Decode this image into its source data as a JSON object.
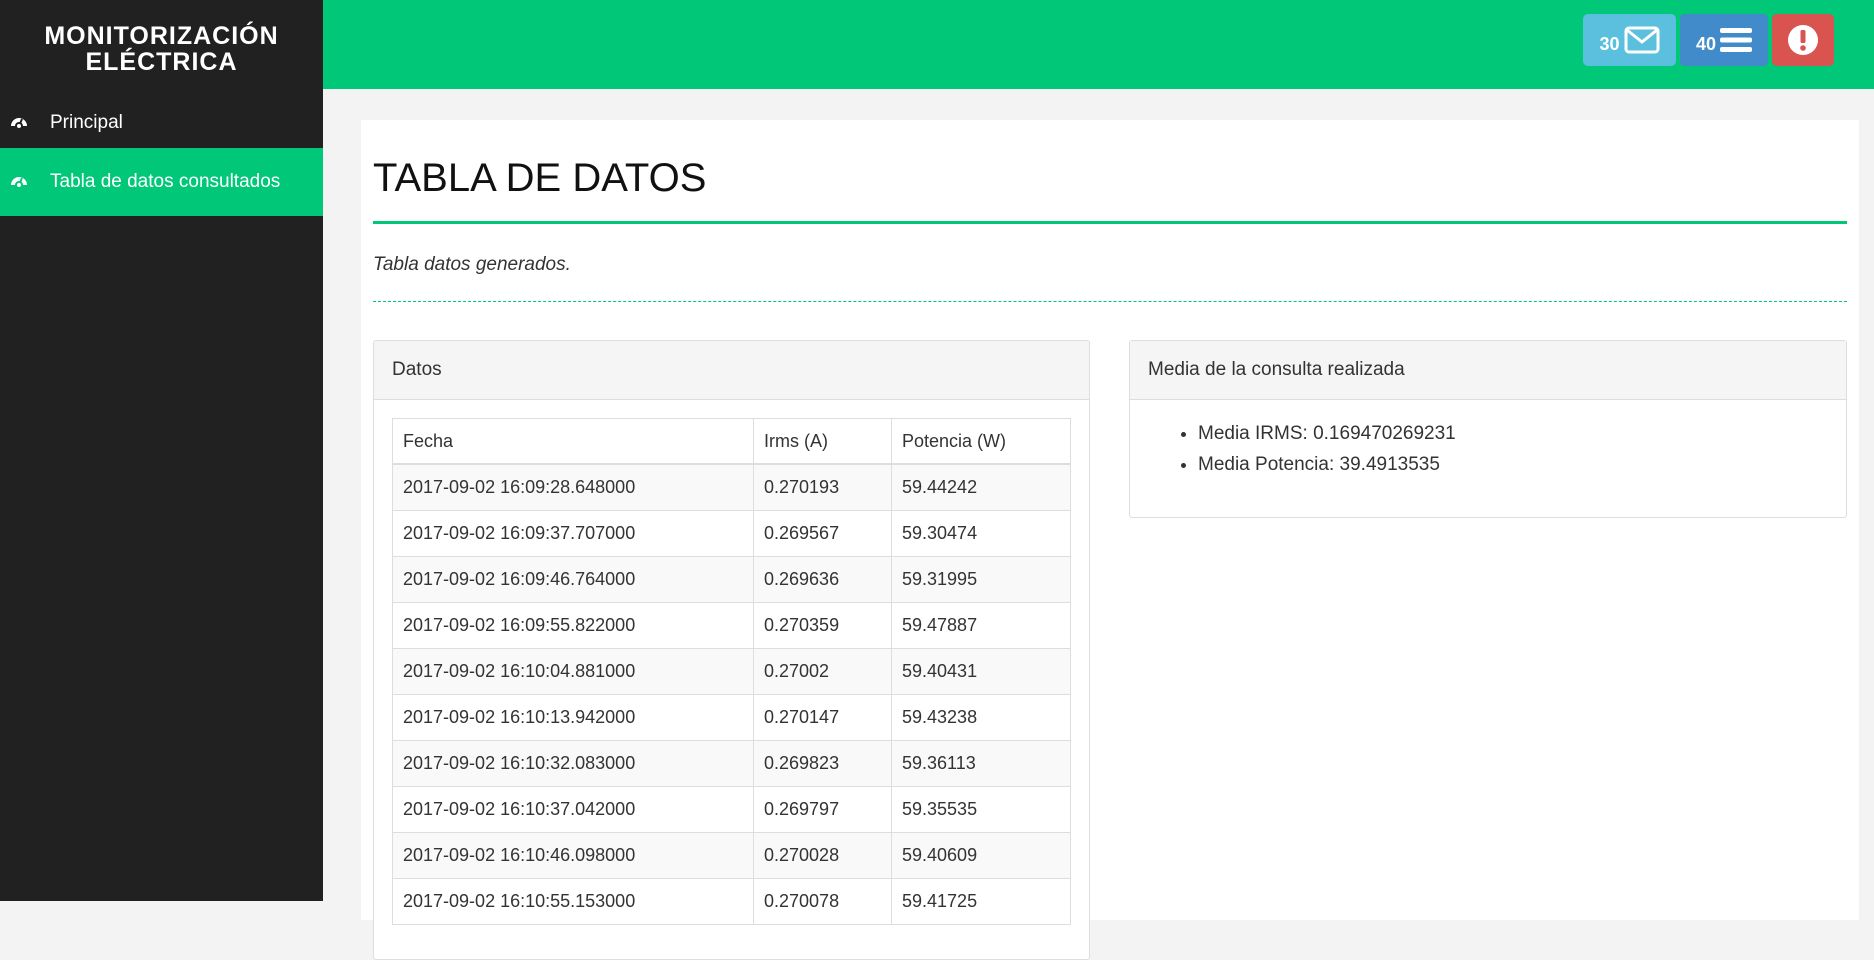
{
  "sidebar": {
    "brand": "MONITORIZACIÓN ELÉCTRICA",
    "items": [
      {
        "label": "Principal",
        "icon": "dashboard-icon"
      },
      {
        "label": "Tabla de datos consultados",
        "icon": "dashboard-icon",
        "active": true
      }
    ]
  },
  "topbar": {
    "messages": {
      "count": "30",
      "icon": "envelope-icon"
    },
    "tasks": {
      "count": "40",
      "icon": "list-icon"
    },
    "alerts": {
      "icon": "exclamation-icon"
    }
  },
  "colors": {
    "accent": "#00c878",
    "sidebar": "#212121",
    "info": "#5bc0de",
    "primary": "#428bca",
    "danger": "#d9534f"
  },
  "page": {
    "title": "TABLA DE DATOS",
    "subtitle": "Tabla datos generados."
  },
  "datos_panel": {
    "heading": "Datos",
    "columns": [
      "Fecha",
      "Irms (A)",
      "Potencia (W)"
    ],
    "rows": [
      [
        "2017-09-02 16:09:28.648000",
        "0.270193",
        "59.44242"
      ],
      [
        "2017-09-02 16:09:37.707000",
        "0.269567",
        "59.30474"
      ],
      [
        "2017-09-02 16:09:46.764000",
        "0.269636",
        "59.31995"
      ],
      [
        "2017-09-02 16:09:55.822000",
        "0.270359",
        "59.47887"
      ],
      [
        "2017-09-02 16:10:04.881000",
        "0.27002",
        "59.40431"
      ],
      [
        "2017-09-02 16:10:13.942000",
        "0.270147",
        "59.43238"
      ],
      [
        "2017-09-02 16:10:32.083000",
        "0.269823",
        "59.36113"
      ],
      [
        "2017-09-02 16:10:37.042000",
        "0.269797",
        "59.35535"
      ],
      [
        "2017-09-02 16:10:46.098000",
        "0.270028",
        "59.40609"
      ],
      [
        "2017-09-02 16:10:55.153000",
        "0.270078",
        "59.41725"
      ]
    ]
  },
  "media_panel": {
    "heading": "Media de la consulta realizada",
    "items": [
      "Media IRMS: 0.169470269231",
      "Media Potencia: 39.4913535"
    ]
  }
}
